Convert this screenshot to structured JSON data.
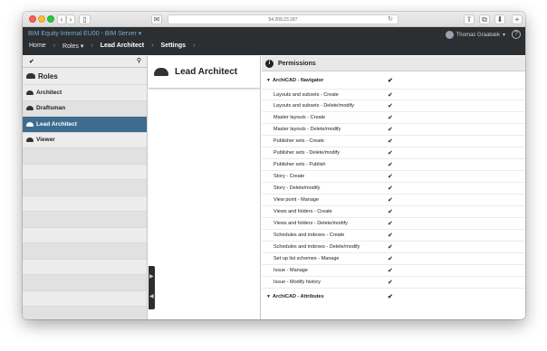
{
  "browser": {
    "address": "54.209.23.187"
  },
  "app": {
    "title": "BIM Equity Internal EU00 - BIM Server",
    "title_caret": "▾",
    "breadcrumbs": [
      "Home",
      "Roles ▾",
      "Lead Architect",
      "Settings"
    ],
    "user": "Thomas Graabæk",
    "user_caret": "▾",
    "help": "?"
  },
  "left": {
    "check_glyph": "✔",
    "search_glyph": "⚲",
    "heading": "Roles",
    "items": [
      {
        "label": "Architect"
      },
      {
        "label": "Draftsman"
      },
      {
        "label": "Lead Architect"
      },
      {
        "label": "Viewer"
      }
    ]
  },
  "middle": {
    "title": "Lead Architect",
    "collapse_up": "▶",
    "collapse_down": "◀"
  },
  "permissions": {
    "header": "Permissions",
    "info_glyph": "i",
    "check": "✔",
    "groups": [
      {
        "label": "ArchiCAD - Navigator",
        "items": [
          "Layouts and subsets - Create",
          "Layouts and subsets - Delete/modify",
          "Master layouts - Create",
          "Master layouts - Delete/modify",
          "Publisher sets - Create",
          "Publisher sets - Delete/modify",
          "Publisher sets - Publish",
          "Story - Create",
          "Story - Delete/modify",
          "View point - Manage",
          "Views and folders - Create",
          "Views and folders - Delete/modify",
          "Schedules and indexes - Create",
          "Schedules and indexes - Delete/modify",
          "Set up list schemes - Manage",
          "Issue - Manage",
          "Issue - Modify history"
        ]
      },
      {
        "label": "ArchiCAD - Attributes",
        "items": []
      }
    ]
  },
  "colors": {
    "header_bg": "#2c2f31",
    "accent_title": "#77a9c9",
    "selected_row": "#3e6c8f"
  }
}
